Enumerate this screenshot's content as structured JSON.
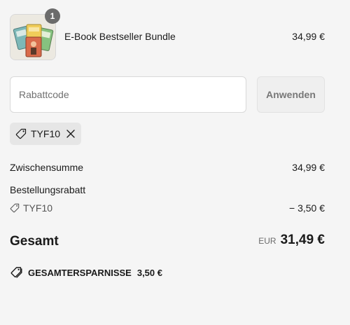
{
  "line_item": {
    "quantity": "1",
    "name": "E-Book Bestseller Bundle",
    "price": "34,99 €"
  },
  "discount": {
    "placeholder": "Rabattcode",
    "apply_label": "Anwenden",
    "applied_code": "TYF10"
  },
  "summary": {
    "subtotal_label": "Zwischensumme",
    "subtotal_value": "34,99 €",
    "order_discount_label": "Bestellungsrabatt",
    "order_discount_code": "TYF10",
    "order_discount_value": "− 3,50 €",
    "total_label": "Gesamt",
    "currency": "EUR",
    "total_value": "31,49 €",
    "savings_label": "GESAMTERSPARNISSE",
    "savings_value": "3,50 €"
  },
  "icons": {
    "tag": "tag-icon",
    "close": "close-icon",
    "tags": "tags-icon"
  },
  "colors": {
    "background": "#f5f5f5",
    "badge": "#6b6b6b",
    "tag_chip": "#e6e6e6"
  }
}
